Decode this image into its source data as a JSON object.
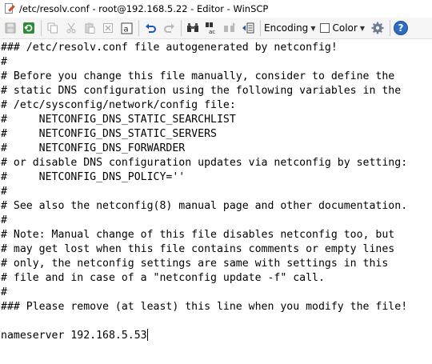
{
  "window": {
    "title": "/etc/resolv.conf - root@192.168.5.22 - Editor - WinSCP"
  },
  "toolbar": {
    "buttons": [
      {
        "name": "save-icon",
        "enabled": false
      },
      {
        "name": "reload-icon",
        "enabled": true
      },
      {
        "name": "copy-icon",
        "enabled": false
      },
      {
        "name": "cut-icon",
        "enabled": false
      },
      {
        "name": "paste-icon",
        "enabled": false
      },
      {
        "name": "delete-icon",
        "enabled": false
      },
      {
        "name": "select-all-icon",
        "enabled": true
      },
      {
        "name": "undo-icon",
        "enabled": true
      },
      {
        "name": "redo-icon",
        "enabled": false
      },
      {
        "name": "find-icon",
        "enabled": true
      },
      {
        "name": "replace-icon",
        "enabled": true
      },
      {
        "name": "find-next-icon",
        "enabled": false
      },
      {
        "name": "goto-line-icon",
        "enabled": true
      }
    ],
    "encoding_label": "Encoding",
    "color_label": "Color",
    "settings_icon": "gear-icon",
    "help_icon": "help-icon"
  },
  "editor": {
    "lines": [
      "### /etc/resolv.conf file autogenerated by netconfig!",
      "#",
      "# Before you change this file manually, consider to define the",
      "# static DNS configuration using the following variables in the",
      "# /etc/sysconfig/network/config file:",
      "#     NETCONFIG_DNS_STATIC_SEARCHLIST",
      "#     NETCONFIG_DNS_STATIC_SERVERS",
      "#     NETCONFIG_DNS_FORWARDER",
      "# or disable DNS configuration updates via netconfig by setting:",
      "#     NETCONFIG_DNS_POLICY=''",
      "#",
      "# See also the netconfig(8) manual page and other documentation.",
      "#",
      "# Note: Manual change of this file disables netconfig too, but",
      "# may get lost when this file contains comments or empty lines",
      "# only, the netconfig settings are same with settings in this",
      "# file and in case of a \"netconfig update -f\" call.",
      "#",
      "### Please remove (at least) this line when you modify the file!",
      "",
      "nameserver 192.168.5.53"
    ]
  }
}
